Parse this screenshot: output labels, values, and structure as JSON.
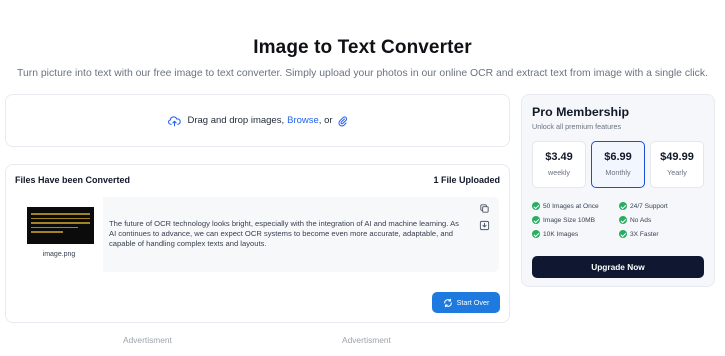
{
  "header": {
    "title": "Image to Text Converter",
    "subtitle": "Turn picture into text with our free image to text converter. Simply upload your photos in our online OCR and extract text from image with a single click."
  },
  "upload": {
    "text_prefix": "Drag and drop images,",
    "browse_label": "Browse",
    "text_suffix": ", or",
    "icons": [
      "cloud-upload-icon",
      "paperclip-icon"
    ]
  },
  "files": {
    "heading": "Files Have been Converted",
    "count_label": "1 File Uploaded",
    "items": [
      {
        "filename": "image.png",
        "text": "The future of OCR technology looks bright, especially with the integration of AI and machine learning. As AI continues to advance, we can expect OCR systems to become even more accurate, adaptable, and capable of handling complex texts and layouts."
      }
    ],
    "start_over_label": "Start Over"
  },
  "ads": [
    "Advertisment",
    "Advertisment"
  ],
  "pro": {
    "title": "Pro Membership",
    "subtitle": "Unlock all premium features",
    "plans": [
      {
        "price": "$3.49",
        "period": "weekly",
        "selected": false
      },
      {
        "price": "$6.99",
        "period": "Monthly",
        "selected": true
      },
      {
        "price": "$49.99",
        "period": "Yearly",
        "selected": false
      }
    ],
    "features": [
      "50 Images at Once",
      "24/7 Support",
      "Image Size 10MB",
      "No Ads",
      "10K Images",
      "3X Faster"
    ],
    "upgrade_label": "Upgrade Now"
  },
  "colors": {
    "accent": "#1f7ae0",
    "link": "#2563eb",
    "check": "#27ae60",
    "dark_button": "#0f1830"
  }
}
